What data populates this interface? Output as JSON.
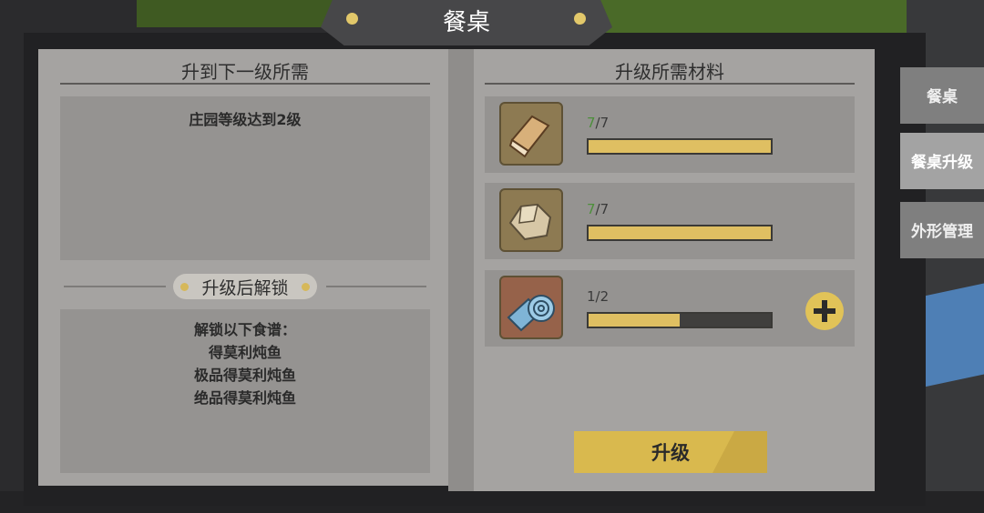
{
  "title": "餐桌",
  "left": {
    "requirements_title": "升到下一级所需",
    "requirement": "庄园等级达到2级",
    "unlock_title": "升级后解锁",
    "unlock_lines": [
      "解锁以下食谱：",
      "得莫利炖鱼",
      "极品得莫利炖鱼",
      "绝品得莫利炖鱼"
    ]
  },
  "right": {
    "materials_title": "升级所需材料",
    "materials": [
      {
        "icon": "wood-icon",
        "have": "7",
        "need": "7",
        "progress": 1.0,
        "show_add": false
      },
      {
        "icon": "stone-icon",
        "have": "7",
        "need": "7",
        "progress": 1.0,
        "show_add": false
      },
      {
        "icon": "cloth-roll-icon",
        "have": "1",
        "need": "2",
        "progress": 0.5,
        "show_add": true
      }
    ],
    "upgrade_label": "升级"
  },
  "side_tabs": [
    {
      "label": "餐桌",
      "active": false
    },
    {
      "label": "餐桌升级",
      "active": true
    },
    {
      "label": "外形管理",
      "active": false
    }
  ]
}
